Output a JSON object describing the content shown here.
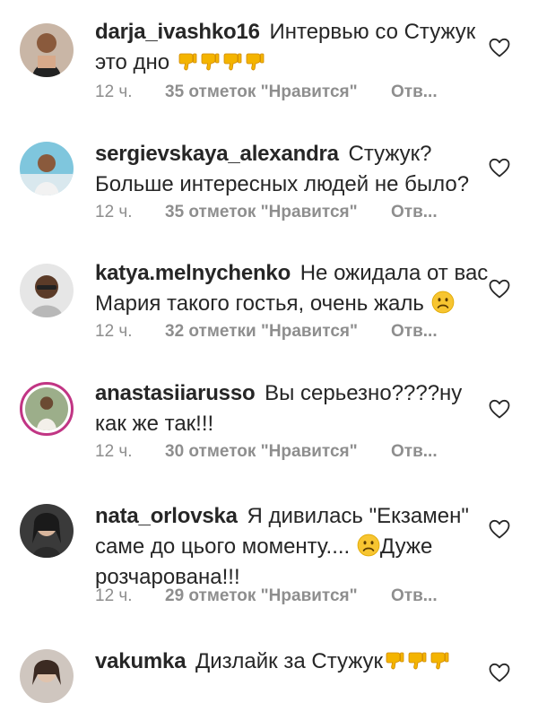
{
  "comments": [
    {
      "username": "darja_ivashko16",
      "text": "Интервью со Стужук это дно",
      "emojis": [
        "thumbs-down-icon",
        "thumbs-down-icon",
        "thumbs-down-icon",
        "thumbs-down-icon"
      ],
      "time": "12 ч.",
      "likes": "35 отметок \"Нравится\"",
      "reply": "Отв..."
    },
    {
      "username": "sergievskaya_alexandra",
      "text": "Стужук? Больше интересных людей не было?",
      "emojis": [],
      "time": "12 ч.",
      "likes": "35 отметок \"Нравится\"",
      "reply": "Отв..."
    },
    {
      "username": "katya.melnychenko",
      "text": "Не ожидала от вас Мария такого гостья, очень жаль",
      "emojis": [
        "confused-face-icon"
      ],
      "time": "12 ч.",
      "likes": "32 отметки \"Нравится\"",
      "reply": "Отв..."
    },
    {
      "username": "anastasiiarusso",
      "text": "Вы серьезно????ну как же так!!!",
      "emojis": [],
      "time": "12 ч.",
      "likes": "30 отметок \"Нравится\"",
      "reply": "Отв..."
    },
    {
      "username": "nata_orlovska",
      "text_before": "Я дивилась \"Екзамен\" саме до цього моменту....",
      "text_after": "Дуже розчарована!!!",
      "emojis": [
        "confused-face-icon"
      ],
      "time": "12 ч.",
      "likes": "29 отметок \"Нравится\"",
      "reply": "Отв..."
    },
    {
      "username": "vakumka",
      "text": "Дизлайк за Стужук",
      "emojis": [
        "thumbs-down-icon",
        "thumbs-down-icon",
        "thumbs-down-icon"
      ]
    }
  ]
}
